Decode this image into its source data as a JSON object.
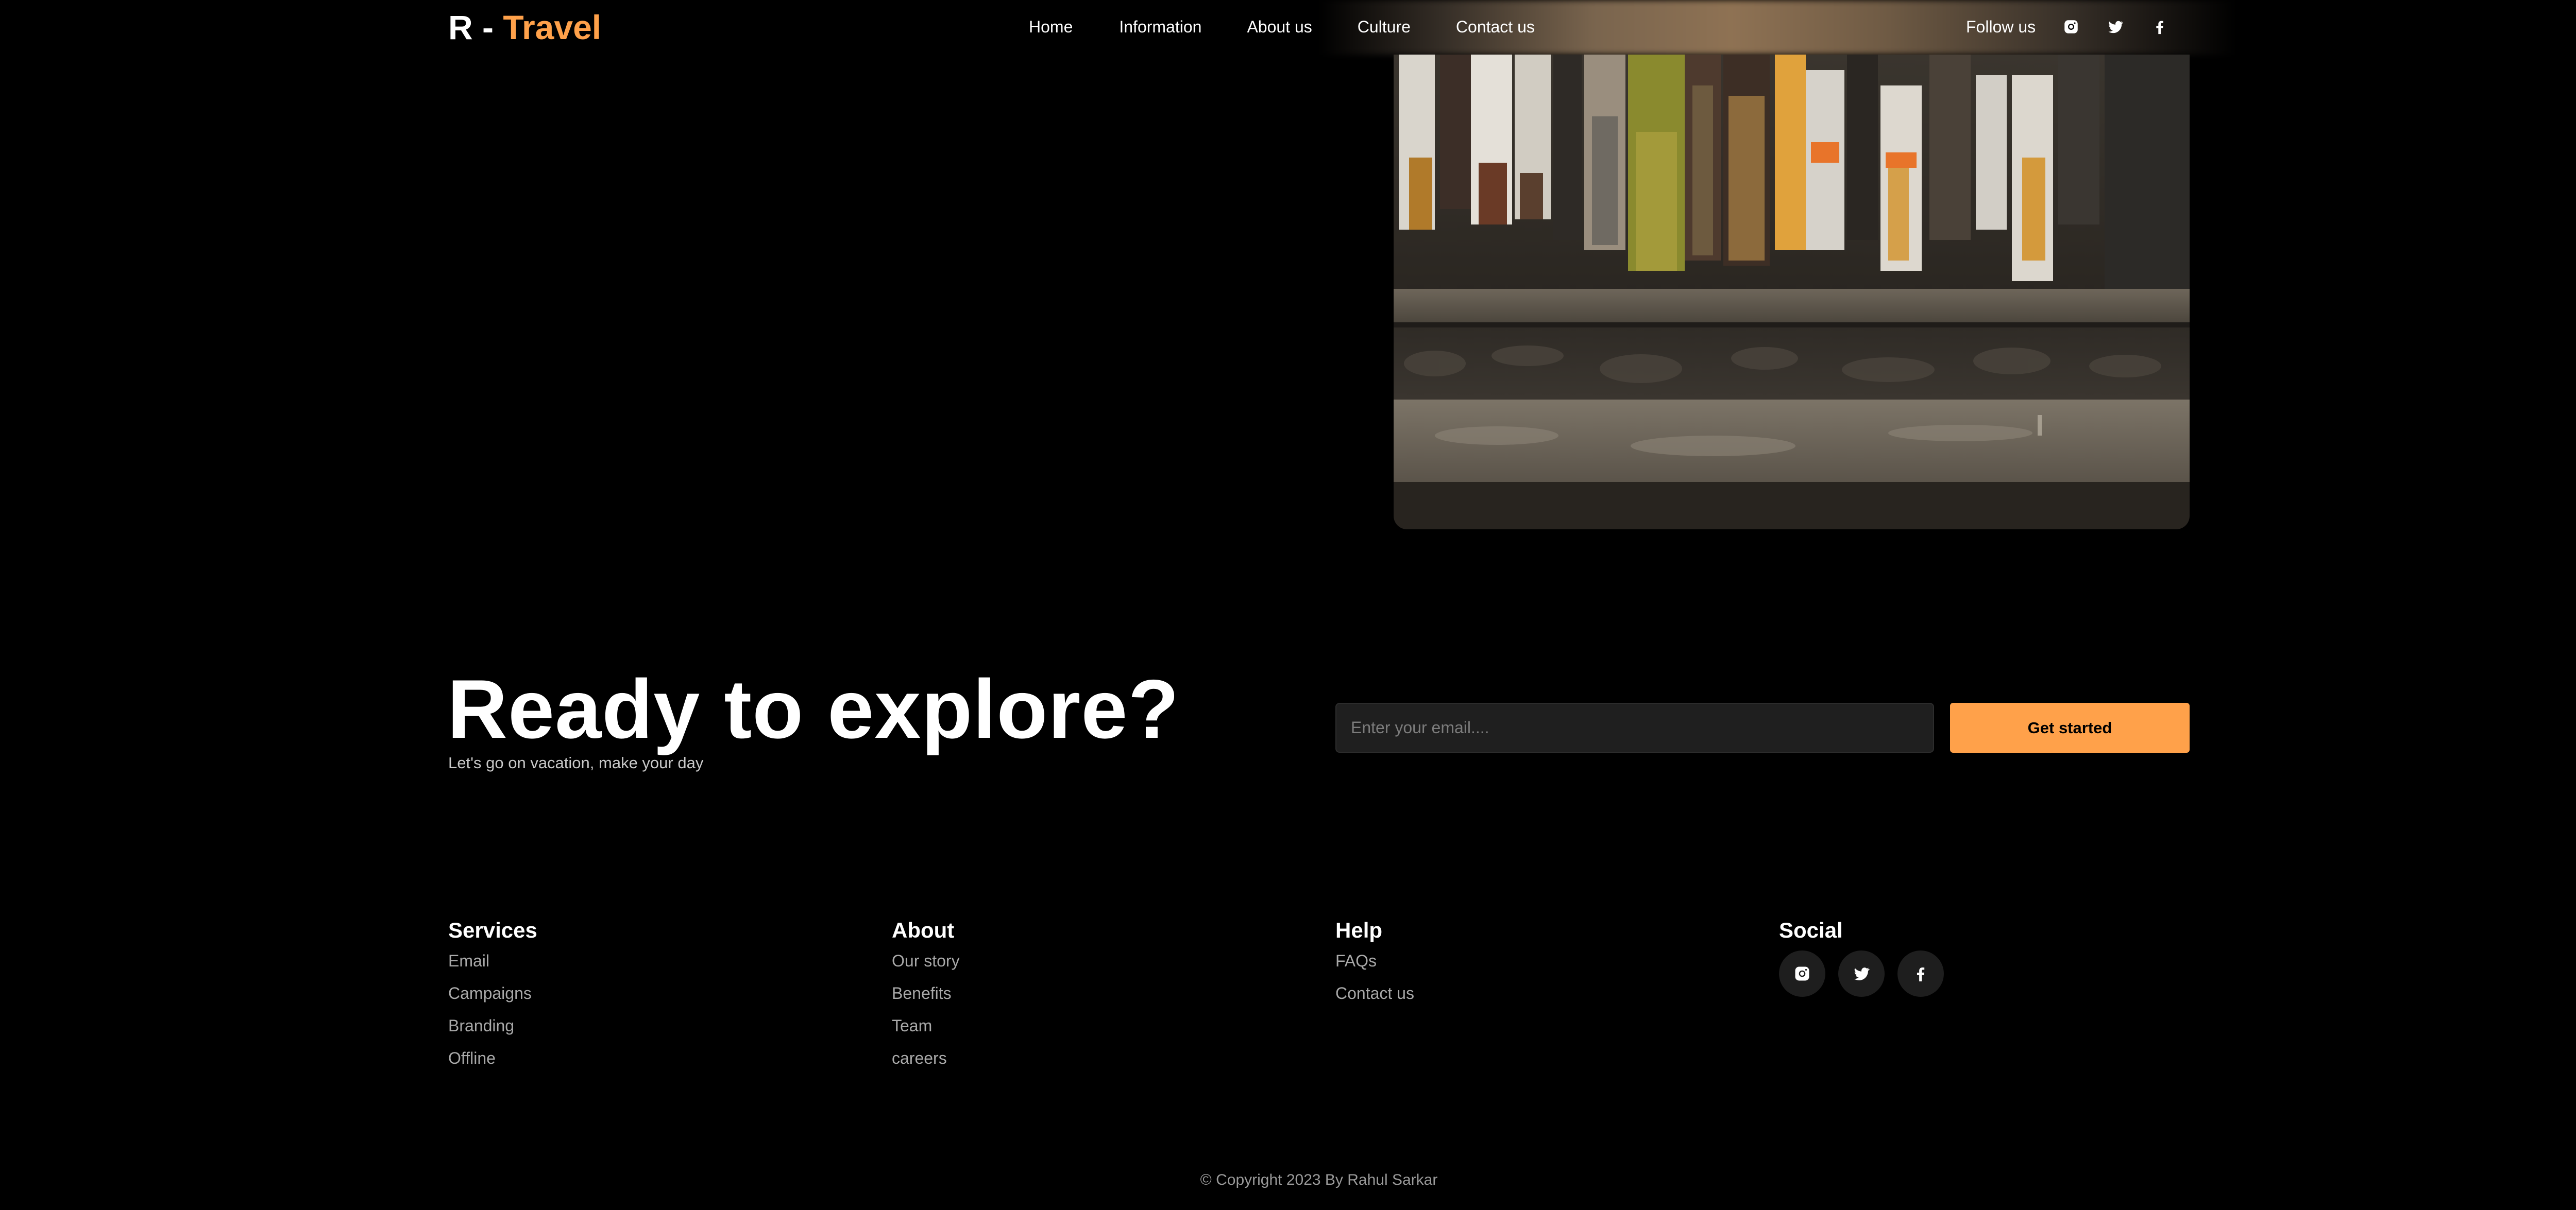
{
  "header": {
    "logo_prefix": "R - ",
    "logo_accent": "Travel",
    "nav": [
      "Home",
      "Information",
      "About us",
      "Culture",
      "Contact us"
    ],
    "follow_label": "Follow us",
    "social_icons": [
      "instagram-icon",
      "twitter-icon",
      "facebook-icon"
    ]
  },
  "cta": {
    "title": "Ready to explore?",
    "subtitle": "Let's go on vacation, make your day",
    "email_placeholder": "Enter your email....",
    "button_label": "Get started"
  },
  "footer": {
    "columns": [
      {
        "heading": "Services",
        "links": [
          "Email",
          "Campaigns",
          "Branding",
          "Offline"
        ]
      },
      {
        "heading": "About",
        "links": [
          "Our story",
          "Benefits",
          "Team",
          "careers"
        ]
      },
      {
        "heading": "Help",
        "links": [
          "FAQs",
          "Contact us"
        ]
      },
      {
        "heading": "Social",
        "icons": [
          "instagram-icon",
          "twitter-icon",
          "facebook-icon"
        ]
      }
    ],
    "copyright": "© Copyright 2023 By Rahul Sarkar"
  },
  "colors": {
    "background": "#000000",
    "accent": "#ffa14a",
    "text": "#ffffff",
    "muted_text": "#a9a9a9",
    "input_bg": "#1f1f1f",
    "social_btn_bg": "#1e1e1e"
  }
}
